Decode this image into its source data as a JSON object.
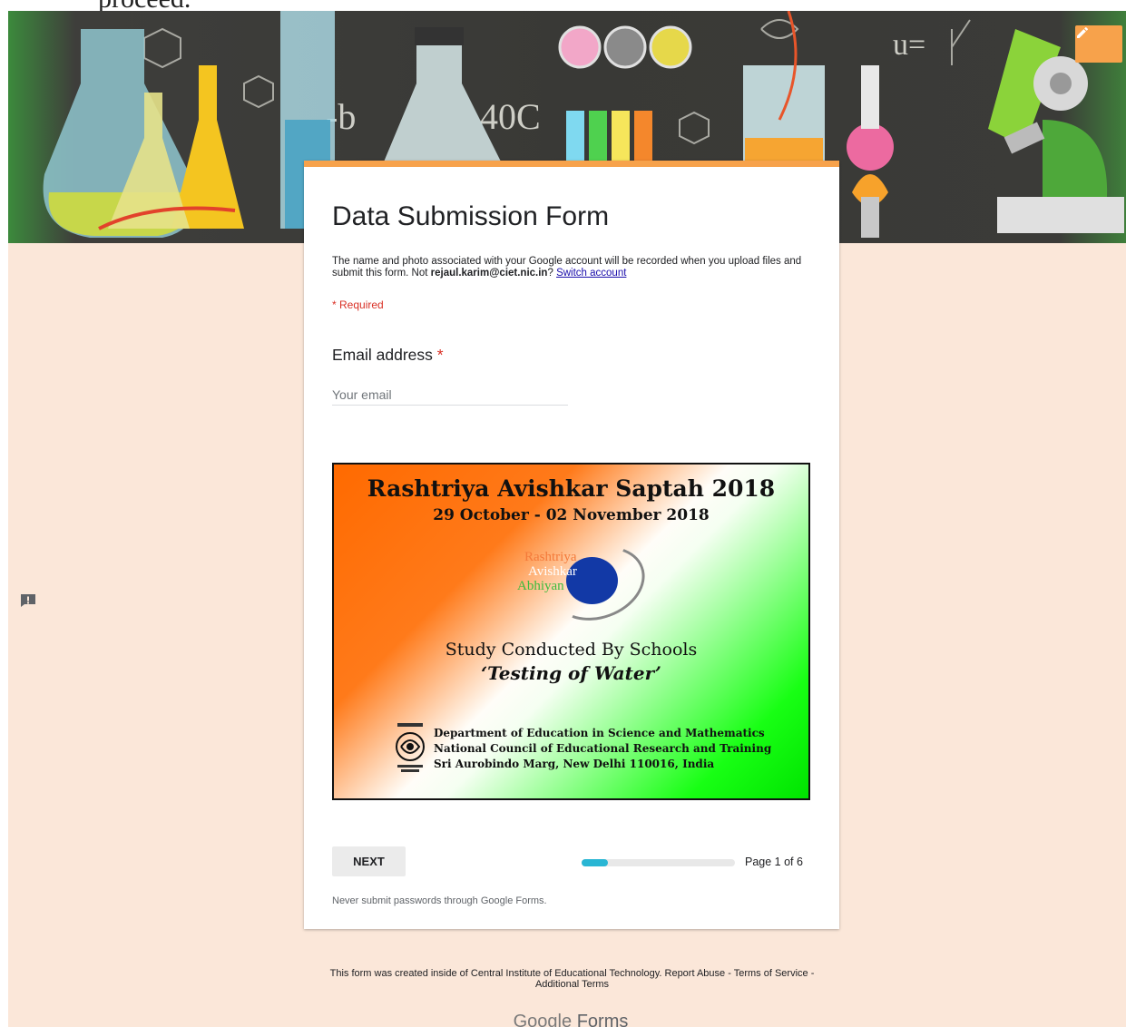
{
  "page_top_clip": "proceed.",
  "colors": {
    "accent": "#f7a24b",
    "background": "#fbe7d9",
    "progress": "#29b6d4",
    "required": "#d93025"
  },
  "banner": {
    "edit_icon": "pencil-icon",
    "banner_text": [
      "-b",
      "40C",
      "u="
    ]
  },
  "form": {
    "title": "Data Submission Form",
    "notice_prefix": "The name and photo associated with your Google account will be recorded when you upload files and submit this form. Not ",
    "notice_email": "rejaul.karim@ciet.nic.in",
    "notice_mid": "? ",
    "switch_account": "Switch account",
    "required_note": "* Required",
    "question_label": "Email address",
    "required_star": "*",
    "email_placeholder": "Your email"
  },
  "poster": {
    "title": "Rashtriya Avishkar Saptah 2018",
    "dates": "29 October - 02 November 2018",
    "logo_lines": [
      "Rashtriya",
      "Avishkar",
      "Abhiyan"
    ],
    "study_line": "Study Conducted By Schools",
    "study_title": "‘Testing of Water’",
    "dept_lines": [
      "Department of Education in Science and Mathematics",
      "National Council of Educational Research and Training",
      "Sri Aurobindo Marg, New Delhi 110016, India"
    ]
  },
  "navigation": {
    "next_label": "NEXT",
    "progress_fraction": 0.17,
    "page_text": "Page 1 of 6"
  },
  "warning": "Never submit passwords through Google Forms.",
  "footer": {
    "text": "This form was created inside of Central Institute of Educational Technology. Report Abuse - Terms of Service - Additional Terms",
    "brand_google": "Google",
    "brand_forms": "Forms"
  },
  "feedback_icon": "report-feedback-icon"
}
